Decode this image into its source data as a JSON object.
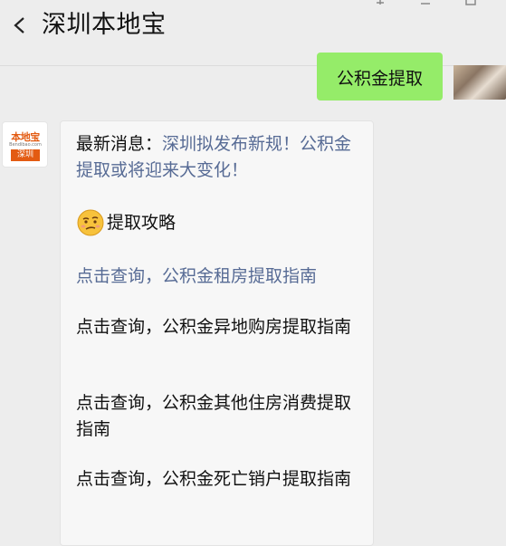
{
  "header": {
    "title": "深圳本地宝",
    "back_icon": "chevron-left-icon"
  },
  "outgoing": {
    "text": "公积金提取"
  },
  "incoming": {
    "account_logo_text": "本地宝",
    "account_logo_sub": "Bendibao.com",
    "account_logo_badge": "深圳",
    "news_prefix": "最新消息：",
    "news_link": "深圳拟发布新规！公积金提取或将迎来大变化！",
    "section_title": "提取攻略",
    "items": [
      "点击查询，公积金租房提取指南",
      "点击查询，公积金异地购房提取指南",
      "点击查询，公积金其他住房消费提取指南",
      "点击查询，公积金死亡销户提取指南"
    ]
  },
  "colors": {
    "background": "#ededed",
    "outgoing_bubble": "#95ec69",
    "incoming_bubble": "#f7f7f7",
    "link": "#576b95",
    "brand": "#e35b12"
  }
}
